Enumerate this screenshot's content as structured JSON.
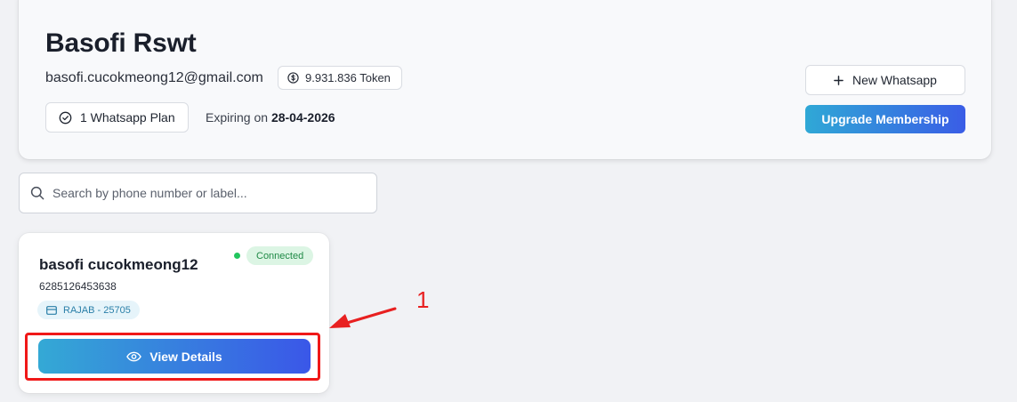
{
  "colors": {
    "accent_start": "#2fa8d6",
    "accent_end": "#3a5de6",
    "connected_green": "#22c55e",
    "annotation_red": "#f01818"
  },
  "profile": {
    "name": "Basofi Rswt",
    "email": "basofi.cucokmeong12@gmail.com",
    "token_icon": "coin-dollar-icon",
    "token_label": "9.931.836 Token",
    "plan_icon": "check-circle-icon",
    "plan_label": "1 Whatsapp Plan",
    "expiry_prefix": "Expiring on",
    "expiry_date": "28-04-2026"
  },
  "actions": {
    "new_whatsapp_icon": "plus-icon",
    "new_whatsapp_label": "New Whatsapp",
    "upgrade_label": "Upgrade Membership"
  },
  "search": {
    "icon": "search-icon",
    "value": "",
    "placeholder": "Search by phone number or label..."
  },
  "whatsapp_cards": [
    {
      "name": "basofi cucokmeong12",
      "status": "Connected",
      "phone": "6285126453638",
      "label_icon": "card-icon",
      "label": "RAJAB - 25705",
      "view_icon": "eye-icon",
      "view_label": "View Details"
    }
  ],
  "annotation": {
    "number": "1"
  }
}
